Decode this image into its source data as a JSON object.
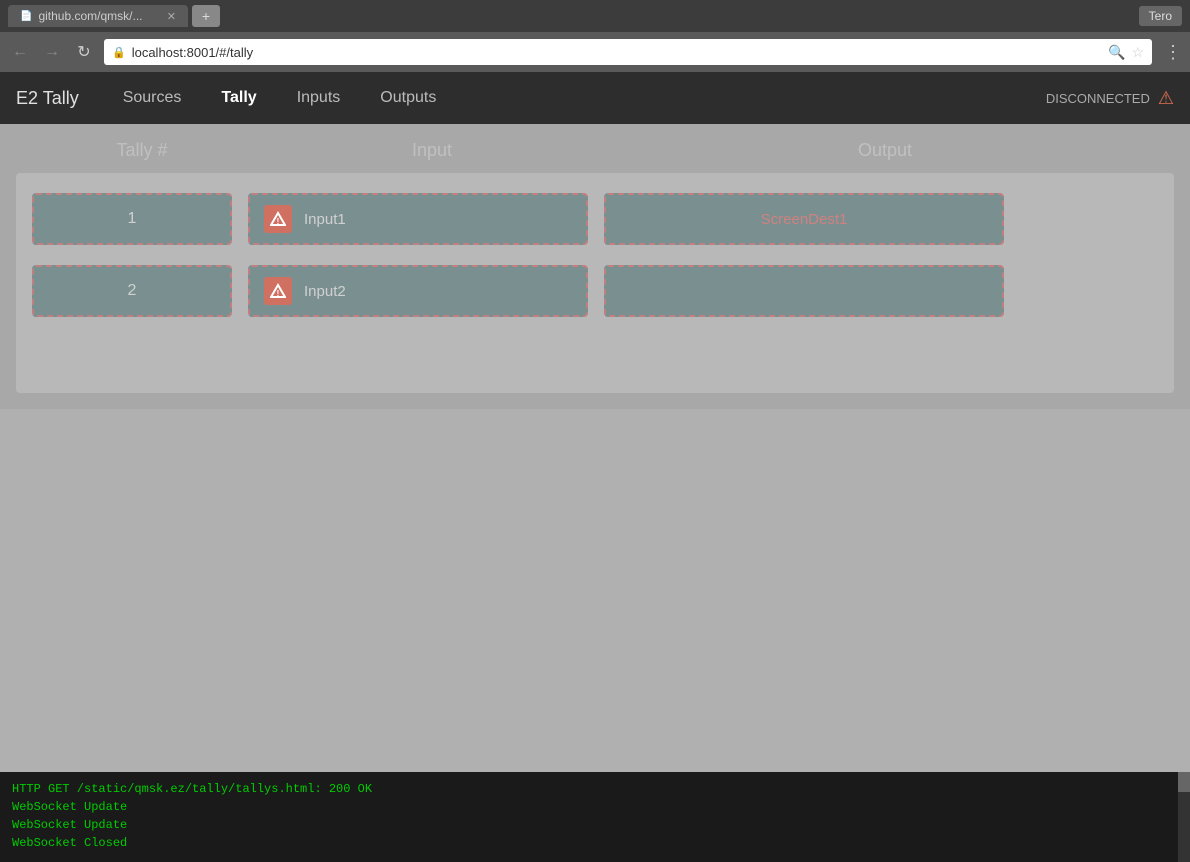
{
  "browser": {
    "tab_title": "github.com/qmsk/...",
    "tab_icon": "📄",
    "new_tab_icon": "+",
    "user_label": "Tero",
    "nav_back": "←",
    "nav_forward": "→",
    "nav_refresh": "↻",
    "url_lock_icon": "🔒",
    "url": "localhost:8001/#/tally",
    "url_search_icon": "🔍",
    "url_star_icon": "★",
    "url_menu_icon": "⋮"
  },
  "app": {
    "brand": "E2 Tally",
    "nav_links": [
      {
        "label": "Sources",
        "active": false
      },
      {
        "label": "Tally",
        "active": true
      },
      {
        "label": "Inputs",
        "active": false
      },
      {
        "label": "Outputs",
        "active": false
      }
    ],
    "status": "DISCONNECTED",
    "warning_icon": "⚠"
  },
  "tally_page": {
    "col_tally_num": "Tally #",
    "col_input": "Input",
    "col_output": "Output",
    "rows": [
      {
        "number": "1",
        "input_label": "Input1",
        "output_label": "ScreenDest1",
        "has_warning": true
      },
      {
        "number": "2",
        "input_label": "Input2",
        "output_label": "",
        "has_warning": true
      }
    ]
  },
  "console": {
    "lines": [
      "HTTP GET /static/qmsk.ez/tally/tallys.html: 200 OK",
      "WebSocket Update",
      "WebSocket Update",
      "WebSocket Closed"
    ]
  }
}
